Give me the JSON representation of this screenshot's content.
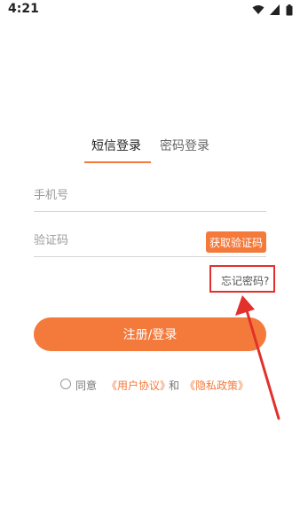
{
  "status_bar": {
    "time": "4:21",
    "icons": [
      "wifi-icon",
      "signal-icon",
      "battery-icon"
    ]
  },
  "tabs": [
    {
      "label": "短信登录",
      "active": true
    },
    {
      "label": "密码登录",
      "active": false
    }
  ],
  "form": {
    "phone_placeholder": "手机号",
    "code_placeholder": "验证码",
    "get_code_label": "获取验证码",
    "forgot_label": "忘记密码?",
    "submit_label": "注册/登录"
  },
  "agreement": {
    "agree_label": "同意",
    "user_agreement": "《用户协议》",
    "and_label": "和",
    "privacy_policy": "《隐私政策》"
  },
  "colors": {
    "accent": "#f47a3c",
    "annotation": "#e2302b"
  }
}
